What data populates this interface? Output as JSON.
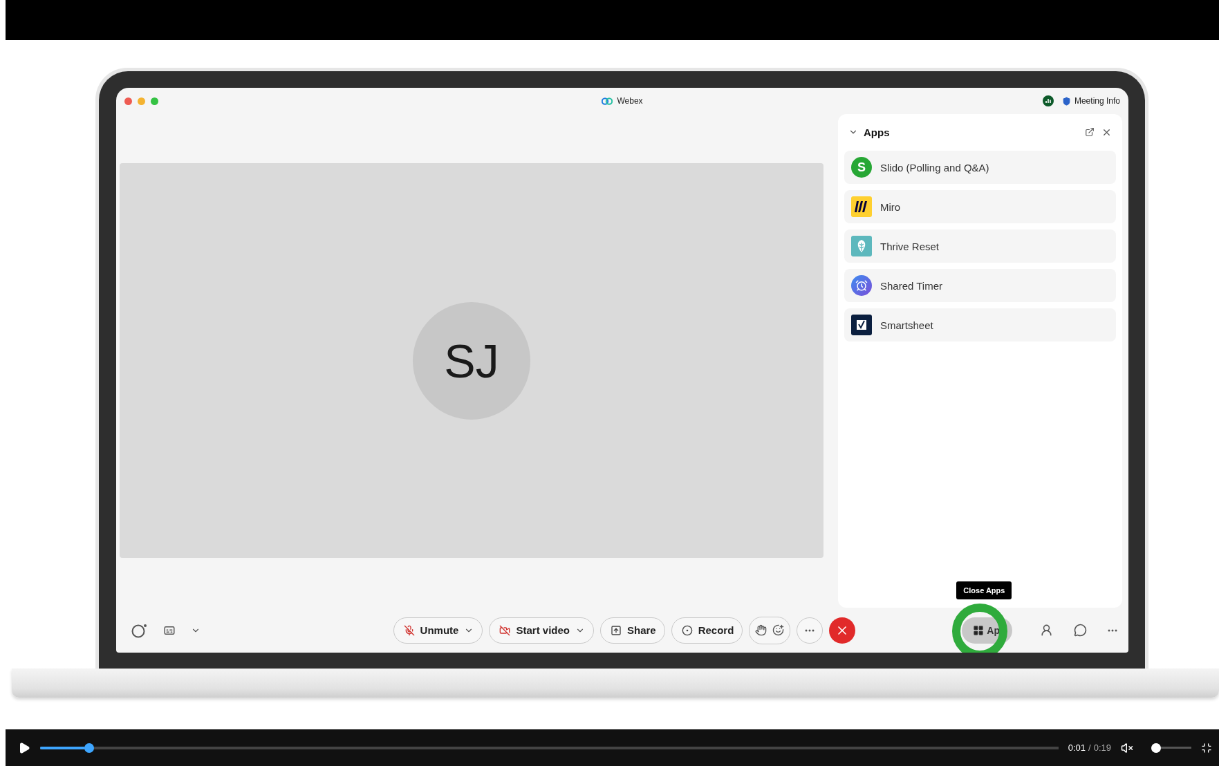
{
  "window": {
    "title": "Webex",
    "meeting_info": "Meeting Info"
  },
  "participant": {
    "initials": "SJ"
  },
  "apps_panel": {
    "title": "Apps",
    "expanded": true,
    "items": [
      {
        "name": "Slido (Polling and Q&A)",
        "kind": "slido",
        "badge": "S"
      },
      {
        "name": "Miro",
        "kind": "miro"
      },
      {
        "name": "Thrive Reset",
        "kind": "thrive"
      },
      {
        "name": "Shared Timer",
        "kind": "timer"
      },
      {
        "name": "Smartsheet",
        "kind": "smartsheet"
      }
    ]
  },
  "toolbar": {
    "buttons": [
      {
        "label": "Unmute",
        "kind": "mic",
        "dropdown": true
      },
      {
        "label": "Start video",
        "kind": "video",
        "dropdown": true
      },
      {
        "label": "Share",
        "kind": "share",
        "dropdown": false
      },
      {
        "label": "Record",
        "kind": "record",
        "dropdown": false
      }
    ],
    "apps_button": {
      "label": "Ap",
      "highlighted": true
    },
    "tooltip": "Close Apps"
  },
  "player": {
    "playing": false,
    "progress": {
      "level": 0.044
    },
    "time_current": "0:01",
    "time_separator": "/",
    "time_total": "0:19",
    "muted": true,
    "volume": {
      "level": 0.0
    }
  }
}
